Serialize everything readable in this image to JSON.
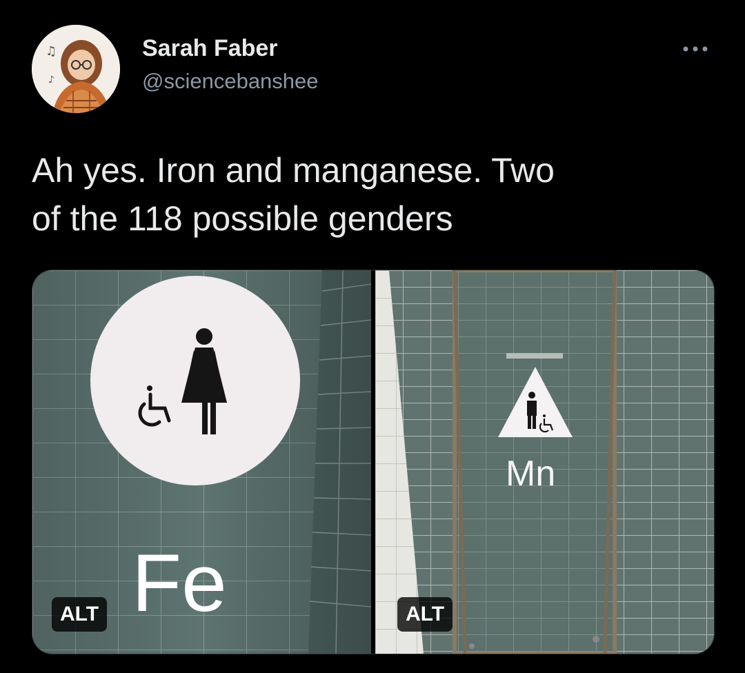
{
  "author": {
    "display_name": "Sarah Faber",
    "handle": "@sciencebanshee"
  },
  "header": {
    "more_icon": "more-horizontal-icon"
  },
  "tweet": {
    "text": "Ah yes. Iron and manganese. Two\nof the 118 possible genders"
  },
  "media": {
    "photos": [
      {
        "sign_label": "Fe",
        "sign_shape": "circle",
        "figure": "female-restroom-icon",
        "accessibility_icon": "wheelchair-icon",
        "alt_badge": "ALT"
      },
      {
        "sign_label": "Mn",
        "sign_shape": "triangle",
        "figure": "male-restroom-icon",
        "accessibility_icon": "wheelchair-icon",
        "alt_badge": "ALT"
      }
    ]
  },
  "colors": {
    "background": "#000000",
    "text_primary": "#e7e9ea",
    "text_secondary": "#8b98a5",
    "tile": "#5e7470",
    "grout": "#c9d0cc"
  }
}
